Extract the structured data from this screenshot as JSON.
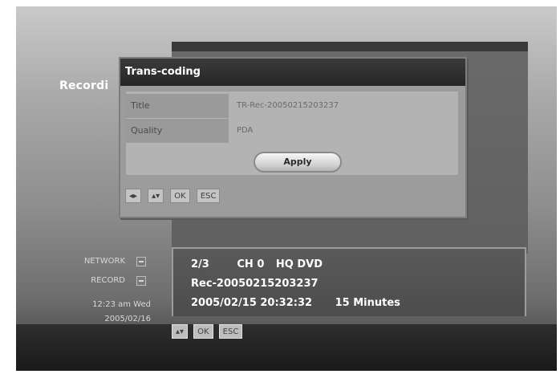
{
  "background_title": "Recordi",
  "dialog": {
    "title": "Trans-coding",
    "rows": [
      {
        "label": "Title",
        "value": "TR-Rec-20050215203237"
      },
      {
        "label": "Quality",
        "value": "PDA"
      }
    ],
    "apply_label": "Apply",
    "keys": [
      "◂▸",
      "▴▾",
      "OK",
      "ESC"
    ]
  },
  "status": {
    "network_label": "NETWORK",
    "record_label": "RECORD",
    "time": "12:23 am Wed",
    "date": "2005/02/16"
  },
  "info": {
    "index": "2/3",
    "channel": "CH  0",
    "mode": "HQ DVD",
    "filename": "Rec-20050215203237",
    "datetime": "2005/02/15 20:32:32",
    "duration": "15 Minutes"
  },
  "bottom_keys": [
    "▴▾",
    "OK",
    "ESC"
  ],
  "colors": {
    "dialog_header": "#2d2d2d",
    "dialog_bg": "#9c9c9c",
    "info_text": "#ffffff"
  }
}
